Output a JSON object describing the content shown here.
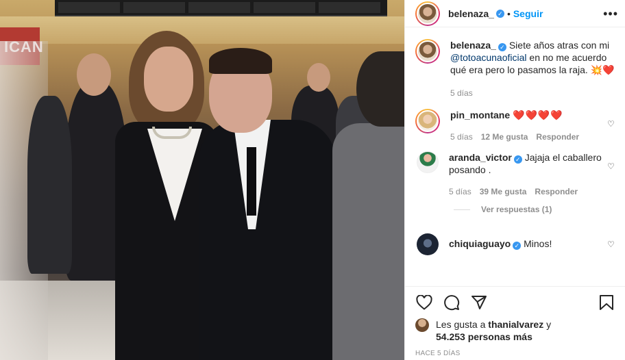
{
  "post": {
    "author": "belenaza_",
    "follow_label": "Seguir",
    "dot": "•",
    "more_label": "•••",
    "caption_text": "Siete años atras con mi",
    "caption_mention": "@totoacunaoficial",
    "caption_rest": "en no me acuerdo qué era pero lo pasamos la raja.",
    "caption_emoji": "💥❤️",
    "caption_time": "5 días"
  },
  "photo": {
    "sign_text": "ICAN"
  },
  "comments": [
    {
      "user": "pin_montane",
      "text": "❤️❤️❤️❤️",
      "time": "5 días",
      "likes": "12 Me gusta",
      "reply": "Responder"
    },
    {
      "user": "aranda_victor",
      "text": "Jajaja el caballero posando .",
      "time": "5 días",
      "likes": "39 Me gusta",
      "reply": "Responder",
      "view_replies": "Ver respuestas (1)"
    },
    {
      "user": "chiquiaguayo",
      "text": "Minos!"
    }
  ],
  "likes": {
    "prefix": "Les gusta a",
    "user": "thanialvarez",
    "and": "y",
    "count": "54.253 personas más"
  },
  "posted_ago": "HACE 5 DÍAS",
  "icons": [
    "heart-icon",
    "comment-icon",
    "share-icon",
    "save-icon",
    "verified-badge-icon"
  ],
  "colors": {
    "accent": "#0095f6",
    "verified": "#3897f0",
    "heart": "#ed4956",
    "muted": "#8e8e8e"
  }
}
